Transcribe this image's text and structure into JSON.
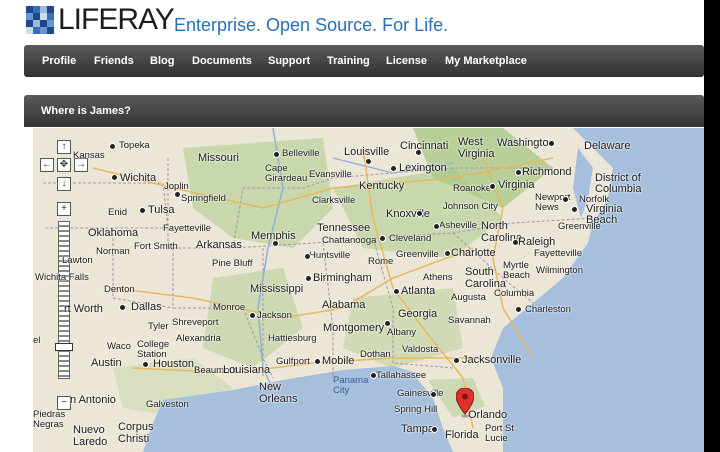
{
  "brand": {
    "name": "LIFERAY",
    "tagline": "Enterprise. Open Source. For Life."
  },
  "nav": [
    "Profile",
    "Friends",
    "Blog",
    "Documents",
    "Support",
    "Training",
    "License",
    "My Marketplace"
  ],
  "panel": {
    "title": "Where is James?"
  },
  "map": {
    "controls": {
      "pan_up": "↑",
      "pan_left": "←",
      "pan_center": "✥",
      "pan_right": "→",
      "pan_down": "↓",
      "zoom_in": "+",
      "zoom_out": "−"
    },
    "labels": {
      "kansas": "Kansas",
      "topeka": "Topeka",
      "missouri": "Missouri",
      "belleville": "Belleville",
      "louisville": "Louisville",
      "cincinnati": "Cincinnati",
      "west_virginia": "West\nVirginia",
      "washington": "Washington",
      "delaware": "Delaware",
      "wichita": "Wichita",
      "cape_girardeau": "Cape\nGirardeau",
      "evansville": "Evansville",
      "lexington": "Lexington",
      "richmond": "Richmond",
      "joplin": "Joplin",
      "springfield": "Springfield",
      "kentucky": "Kentucky",
      "roanoke": "Roanoke",
      "virginia": "Virginia",
      "district_of_columbia": "District of\nColumbia",
      "enid": "Enid",
      "tulsa": "Tulsa",
      "clarksville": "Clarksville",
      "johnson_city": "Johnson City",
      "newport_news": "Newport\nNews",
      "norfolk": "Norfolk",
      "virginia_beach": "Virginia\nBeach",
      "oklahoma": "Oklahoma",
      "fayetteville": "Fayetteville",
      "memphis": "Memphis",
      "tennessee": "Tennessee",
      "knoxville": "Knoxville",
      "asheville": "Asheville",
      "north_carolina": "North\nCarolina",
      "greenville_nc": "Greenville",
      "norman": "Norman",
      "fort_smith": "Fort Smith",
      "arkansas": "Arkansas",
      "chattanooga": "Chattanooga",
      "cleveland": "Cleveland",
      "raleigh": "Raleigh",
      "lawton": "Lawton",
      "huntsville": "Huntsville",
      "greenville_sc": "Greenville",
      "charlotte": "Charlotte",
      "fayetteville_nc": "Fayetteville",
      "pine_bluff": "Pine Bluff",
      "rome": "Rome",
      "south_carolina": "South\nCarolina",
      "myrtle_beach": "Myrtle\nBeach",
      "wilmington": "Wilmington",
      "wichita_falls": "Wichita Falls",
      "birmingham": "Birmingham",
      "athens": "Athens",
      "atlanta": "Atlanta",
      "mississippi": "Mississippi",
      "denton": "Denton",
      "augusta": "Augusta",
      "columbia": "Columbia",
      "fort_worth": "rt Worth",
      "dallas": "Dallas",
      "monroe": "Monroe",
      "alabama": "Alabama",
      "charleston": "Charleston",
      "jackson": "Jackson",
      "tyler": "Tyler",
      "shreveport": "Shreveport",
      "georgia": "Georgia",
      "savannah": "Savannah",
      "montgomery": "Montgomery",
      "albany": "Albany",
      "alexandria": "Alexandria",
      "hattiesburg": "Hattiesburg",
      "el": "el",
      "waco": "Waco",
      "college_station": "College\nStation",
      "valdosta": "Valdosta",
      "mobile": "Mobile",
      "gulfport": "Gulfport",
      "dothan": "Dothan",
      "jacksonville": "Jacksonville",
      "austin": "Austin",
      "houston": "Houston",
      "beaumont": "Beaumont",
      "louisiana": "Louisiana",
      "tallahassee": "Tallahassee",
      "panama_city": "Panama\nCity",
      "new_orleans": "New\nOrleans",
      "gainesville": "Gainesville",
      "san_antonio": "n Antonio",
      "galveston": "Galveston",
      "spring_hill": "Spring Hill",
      "orlando": "Orlando",
      "nuevo_laredo": "Nuevo\nLaredo",
      "corpus_christi": "Corpus\nChristi",
      "tampa": "Tampa",
      "florida": "Florida",
      "port_st_lucie": "Port St\nLucie",
      "piedras_negras": "Piedras\nNegras"
    }
  },
  "colors": {
    "water": "#a5bfdd",
    "land": "#ebe6d6",
    "forest": "#b6cf95",
    "nav_bg": "#3f3f3f",
    "tagline": "#2a6fb5",
    "pin": "#e0302a"
  },
  "icons": {
    "logo": "liferay-mosaic-icon",
    "pin": "map-pin-icon"
  }
}
